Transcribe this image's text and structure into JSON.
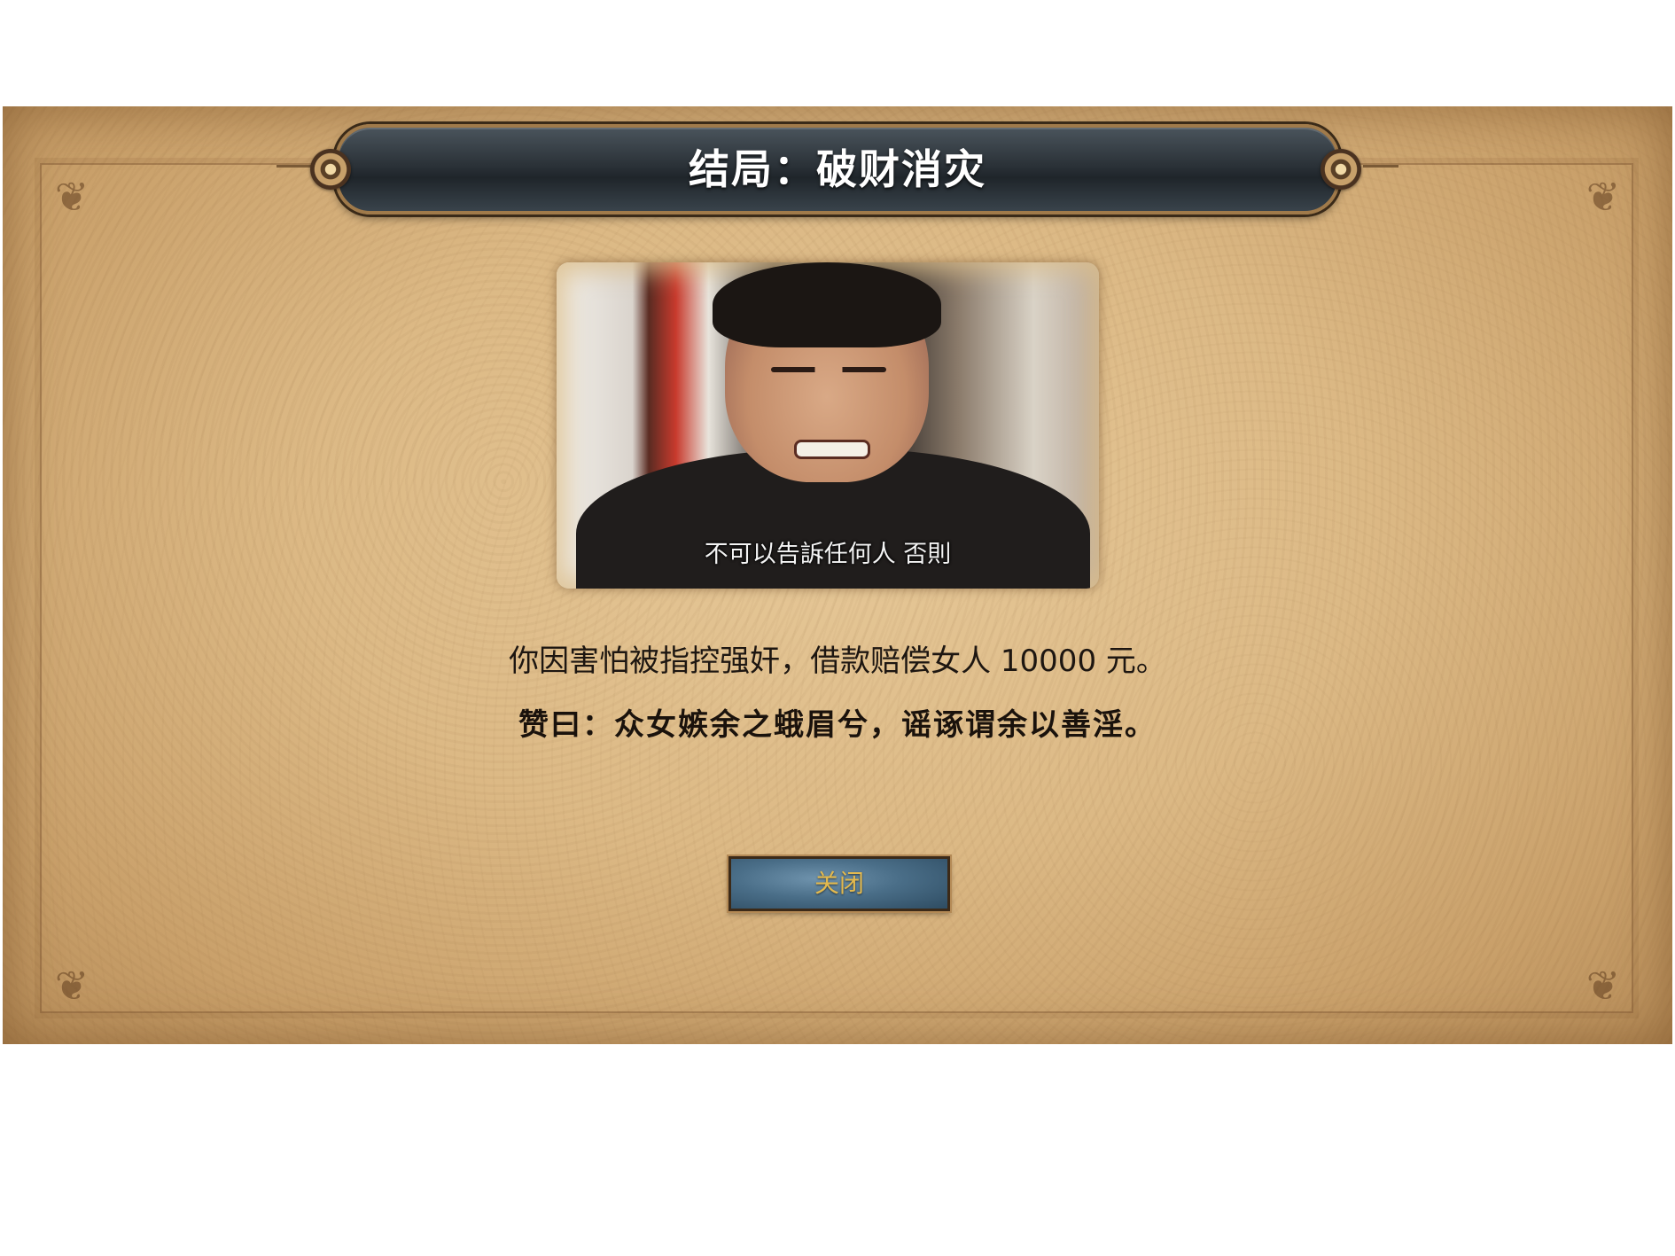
{
  "dialog": {
    "title": "结局：破财消灾",
    "photo_caption": "不可以告訴任何人  否則",
    "description": "你因害怕被指控强奸，借款赔偿女人 10000 元。",
    "verse": "赞曰：众女嫉余之蛾眉兮，谣诼谓余以善淫。",
    "close_label": "关闭"
  },
  "colors": {
    "parchment": "#dcb985",
    "banner": "#2b3238",
    "button": "#4a6e88",
    "button_text": "#e2b94f"
  },
  "icons": {
    "corner": "ornament-corner-icon",
    "banner_end": "banner-medallion-icon"
  }
}
